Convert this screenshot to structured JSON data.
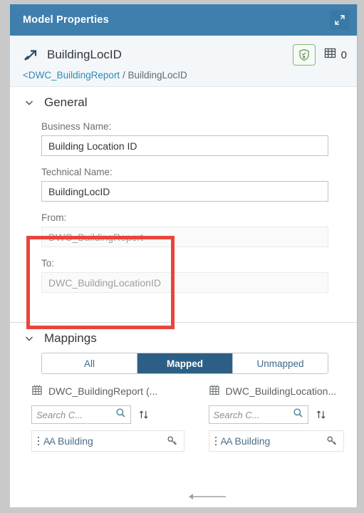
{
  "window": {
    "title": "Model Properties",
    "expand_icon": "expand-fullscreen-icon"
  },
  "object_header": {
    "type_icon": "association-arrow-icon",
    "name": "BuildingLocID",
    "shield_icon": "shield-validation-icon",
    "records_icon": "table-grid-icon",
    "records_count": "0",
    "breadcrumb_parent": "<DWC_BuildingReport",
    "breadcrumb_separator": " / ",
    "breadcrumb_current": "BuildingLocID"
  },
  "general": {
    "caret_icon": "chevron-down-icon",
    "title": "General",
    "business_name_label": "Business Name:",
    "business_name_value": "Building Location ID",
    "technical_name_label": "Technical Name:",
    "technical_name_value": "BuildingLocID",
    "from_label": "From:",
    "from_value": "DWC_BuildingReport",
    "to_label": "To:",
    "to_value": "DWC_BuildingLocationID"
  },
  "mappings": {
    "caret_icon": "chevron-down-icon",
    "title": "Mappings",
    "filter_tabs": [
      {
        "label": "All",
        "active": false
      },
      {
        "label": "Mapped",
        "active": true
      },
      {
        "label": "Unmapped",
        "active": false
      }
    ],
    "source": {
      "table_icon": "table-entity-icon",
      "name": "DWC_BuildingReport (...",
      "search_placeholder": "Search C...",
      "search_value": "",
      "search_icon": "search-magnifier-icon",
      "sort_icon": "sort-arrows-icon",
      "rows": [
        {
          "handle_icon": "drag-dots-icon",
          "type_icon": "AA",
          "label": "Building",
          "key_icon": "key-icon"
        }
      ]
    },
    "target": {
      "table_icon": "table-entity-icon",
      "name": "DWC_BuildingLocation...",
      "search_placeholder": "Search C...",
      "search_value": "",
      "search_icon": "search-magnifier-icon",
      "sort_icon": "sort-arrows-icon",
      "rows": [
        {
          "handle_icon": "drag-dots-icon",
          "type_icon": "AA",
          "label": "Building",
          "key_icon": "key-icon"
        }
      ]
    },
    "connector_icon": "mapping-connector-line"
  },
  "annotation": {
    "highlight_color": "#e8453c"
  },
  "colors": {
    "titlebar": "#3f7fad",
    "accent": "#2c5f86",
    "link": "#2f8ab4",
    "shield_border": "#87b57a"
  }
}
